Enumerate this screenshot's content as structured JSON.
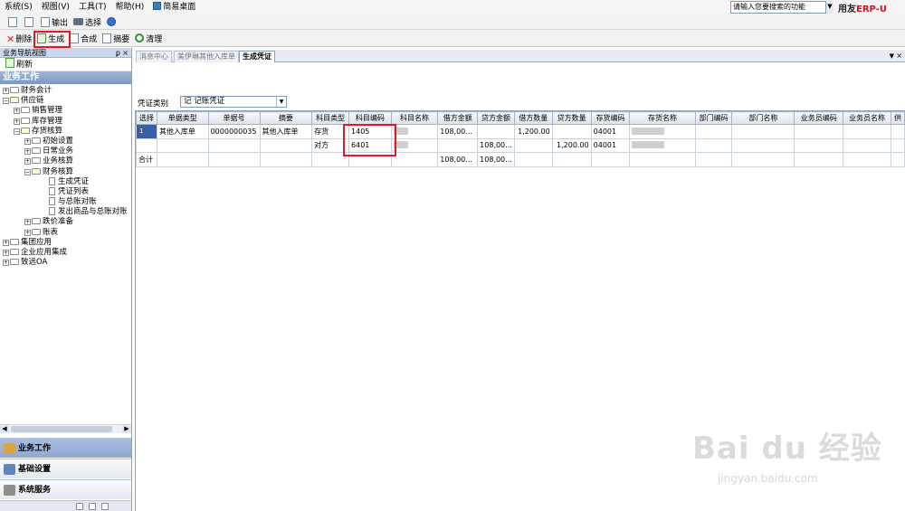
{
  "menubar": {
    "items": [
      "系统(S)",
      "视图(V)",
      "工具(T)",
      "帮助(H)"
    ],
    "desktop_label": "简易桌面",
    "search_placeholder": "请输入您要搜索的功能",
    "brand_text": "用友",
    "brand_erp": "ERP-",
    "brand_suffix": "U"
  },
  "toolbar1": {
    "export_label": "输出",
    "select_label": "选择"
  },
  "toolbar2": {
    "delete_label": "删除",
    "generate_label": "生成",
    "merge_label": "合成",
    "summary_label": "摘要",
    "clear_label": "清理"
  },
  "left_panel": {
    "title": "业务导航视图",
    "pin_glyph": "ꝑ",
    "close_glyph": "×",
    "refresh_label": "刷新",
    "section_title": "业务工作",
    "tree": [
      {
        "label": "财务会计",
        "level": 0,
        "type": "folder",
        "expander": "+"
      },
      {
        "label": "供应链",
        "level": 0,
        "type": "folder-open",
        "expander": "−"
      },
      {
        "label": "销售管理",
        "level": 1,
        "type": "folder",
        "expander": "+"
      },
      {
        "label": "库存管理",
        "level": 1,
        "type": "folder",
        "expander": "+"
      },
      {
        "label": "存货核算",
        "level": 1,
        "type": "folder-open",
        "expander": "−"
      },
      {
        "label": "初始设置",
        "level": 2,
        "type": "folder",
        "expander": "+"
      },
      {
        "label": "日常业务",
        "level": 2,
        "type": "folder",
        "expander": "+"
      },
      {
        "label": "业务核算",
        "level": 2,
        "type": "folder",
        "expander": "+"
      },
      {
        "label": "财务核算",
        "level": 2,
        "type": "folder-open",
        "expander": "−"
      },
      {
        "label": "生成凭证",
        "level": 3,
        "type": "doc",
        "expander": ""
      },
      {
        "label": "凭证列表",
        "level": 3,
        "type": "doc",
        "expander": ""
      },
      {
        "label": "与总账对账",
        "level": 3,
        "type": "doc",
        "expander": ""
      },
      {
        "label": "发出商品与总账对账",
        "level": 3,
        "type": "doc",
        "expander": ""
      },
      {
        "label": "跌价准备",
        "level": 2,
        "type": "folder",
        "expander": "+"
      },
      {
        "label": "账表",
        "level": 2,
        "type": "folder",
        "expander": "+"
      },
      {
        "label": "集团应用",
        "level": 0,
        "type": "folder",
        "expander": "+"
      },
      {
        "label": "企业应用集成",
        "level": 0,
        "type": "folder",
        "expander": "+"
      },
      {
        "label": "致远OA",
        "level": 0,
        "type": "folder",
        "expander": "+"
      }
    ],
    "nav_buttons": {
      "business": "业务工作",
      "basic": "基础设置",
      "system": "系统服务"
    }
  },
  "tabs": [
    {
      "label": "消息中心",
      "active": false
    },
    {
      "label": "美伊琳其他入库单",
      "active": false
    },
    {
      "label": "生成凭证",
      "active": true
    }
  ],
  "tab_controls": {
    "menu_glyph": "▼",
    "close_glyph": "×"
  },
  "voucher": {
    "type_label": "凭证类别",
    "type_value": "记 记账凭证"
  },
  "grid": {
    "columns": [
      "选择",
      "单据类型",
      "单据号",
      "摘要",
      "科目类型",
      "科目编码",
      "科目名称",
      "借方金额",
      "贷方金额",
      "借方数量",
      "贷方数量",
      "存货编码",
      "存货名称",
      "部门编码",
      "部门名称",
      "业务员编码",
      "业务员名称",
      "供"
    ],
    "rows": [
      {
        "select": "1",
        "doc_type": "其他入库单",
        "doc_no": "0000000035",
        "summary": "其他入库单",
        "subject_type": "存货",
        "subject_code": "1405",
        "debit": "108,00...",
        "credit": "",
        "debit_qty": "1,200.00",
        "credit_qty": "",
        "stock_code": "04001"
      },
      {
        "select": "",
        "doc_type": "",
        "doc_no": "",
        "summary": "",
        "subject_type": "对方",
        "subject_code": "6401",
        "debit": "",
        "credit": "108,00...",
        "debit_qty": "",
        "credit_qty": "1,200.00",
        "stock_code": "04001"
      }
    ],
    "total": {
      "label": "合计",
      "debit": "108,00...",
      "credit": "108,00..."
    }
  },
  "watermark": {
    "main": "Bai du 经验",
    "sub": "jingyan.baidu.com"
  }
}
